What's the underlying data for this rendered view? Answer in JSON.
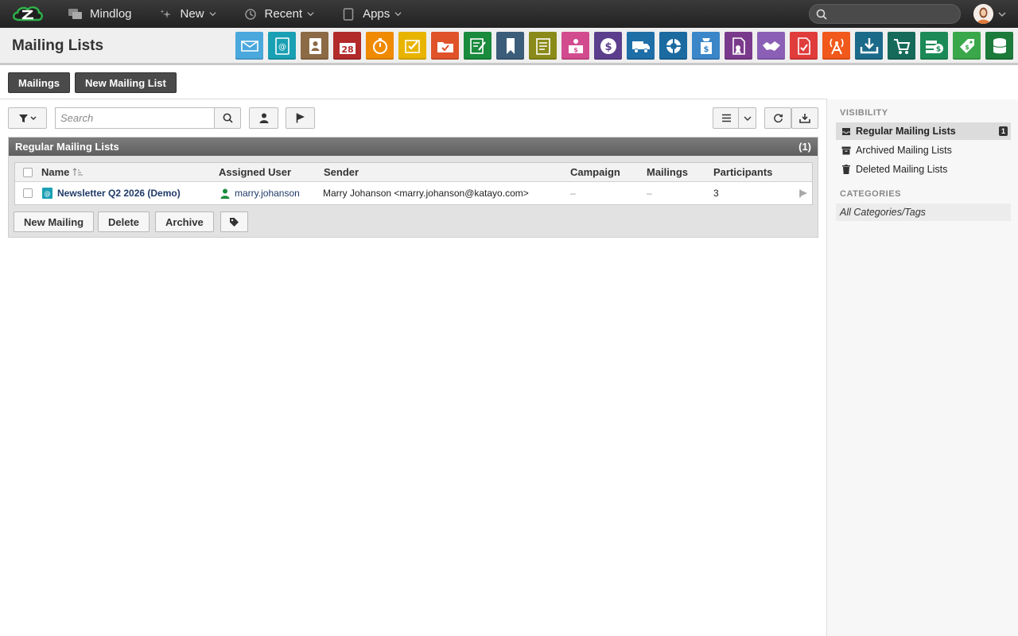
{
  "topbar": {
    "nav": [
      {
        "label": "Mindlog",
        "icon": "chat-icon"
      },
      {
        "label": "New",
        "icon": "sparkle-icon"
      },
      {
        "label": "Recent",
        "icon": "history-icon"
      },
      {
        "label": "Apps",
        "icon": "tablet-icon"
      }
    ]
  },
  "header": {
    "title": "Mailing Lists",
    "calendar_day": "28",
    "apps": [
      {
        "name": "mail-app-icon",
        "color": "#4aa8dd"
      },
      {
        "name": "mailing-list-app-icon",
        "color": "#1aa0b4"
      },
      {
        "name": "contacts-app-icon",
        "color": "#8b6a45"
      },
      {
        "name": "calendar-app-icon",
        "color": "#b22a2a"
      },
      {
        "name": "timer-app-icon",
        "color": "#f08a00"
      },
      {
        "name": "tasks-app-icon",
        "color": "#e8b400"
      },
      {
        "name": "projects-app-icon",
        "color": "#e0522a"
      },
      {
        "name": "notes-app-icon",
        "color": "#1a8a3c"
      },
      {
        "name": "bookmarks-app-icon",
        "color": "#3b5d7a"
      },
      {
        "name": "documents-app-icon",
        "color": "#8a8a1a"
      },
      {
        "name": "pos-app-icon",
        "color": "#d24b8f"
      },
      {
        "name": "finance-app-icon",
        "color": "#5b3f8c"
      },
      {
        "name": "shipping-app-icon",
        "color": "#1e6ea8"
      },
      {
        "name": "support-app-icon",
        "color": "#1b6aa0"
      },
      {
        "name": "payments-app-icon",
        "color": "#3a86c8"
      },
      {
        "name": "contracts-app-icon",
        "color": "#7a3a8c"
      },
      {
        "name": "deals-app-icon",
        "color": "#8b5fb5"
      },
      {
        "name": "invoices-app-icon",
        "color": "#e03c3c"
      },
      {
        "name": "campaigns-app-icon",
        "color": "#f0581c"
      },
      {
        "name": "downloads-app-icon",
        "color": "#1b6a8a"
      },
      {
        "name": "shop-app-icon",
        "color": "#166a5a"
      },
      {
        "name": "cash-app-icon",
        "color": "#1c8a56"
      },
      {
        "name": "pricing-app-icon",
        "color": "#3aa84a"
      },
      {
        "name": "database-app-icon",
        "color": "#1c7a3a"
      }
    ]
  },
  "subtabs": [
    "Mailings",
    "New Mailing List"
  ],
  "toolbar": {
    "search_placeholder": "Search"
  },
  "panel": {
    "title": "Regular Mailing Lists",
    "count": "(1)",
    "columns": [
      "Name",
      "Assigned User",
      "Sender",
      "Campaign",
      "Mailings",
      "Participants"
    ],
    "rows": [
      {
        "name": "Newsletter Q2 2026 (Demo)",
        "assigned_user": "marry.johanson",
        "sender": "Marry Johanson <marry.johanson@katayo.com>",
        "campaign": "–",
        "mailings": "–",
        "participants": "3"
      }
    ],
    "actions": [
      "New Mailing",
      "Delete",
      "Archive"
    ]
  },
  "sidebar": {
    "visibility_heading": "VISIBILITY",
    "items": [
      {
        "label": "Regular Mailing Lists",
        "badge": "1"
      },
      {
        "label": "Archived Mailing Lists"
      },
      {
        "label": "Deleted Mailing Lists"
      }
    ],
    "categories_heading": "CATEGORIES",
    "categories_item": "All Categories/Tags"
  }
}
